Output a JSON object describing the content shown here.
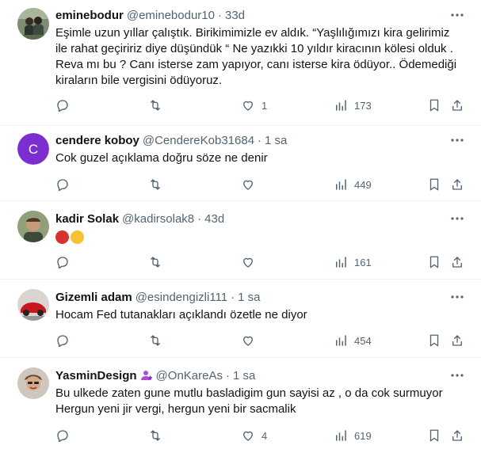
{
  "posts": [
    {
      "name": "eminebodur",
      "handle": "@eminebodur10",
      "time": "33d",
      "lines": [
        "Eşimle uzun yıllar çalıştık. Birikimimizle ev aldık. “Yaşlılığımızı kira gelirimiz",
        "ile rahat geçiririz diye düşündük “ Ne yazıkki 10 yıldır kiracının kölesi olduk .",
        "Reva mı bu ? Canı isterse zam yapıyor, canı isterse kira ödüyor.. Ödemediği",
        "kiraların bile vergisini ödüyoruz."
      ],
      "replies": "",
      "reposts": "",
      "likes": "1",
      "views": "173"
    },
    {
      "name": "cendere koboy",
      "handle": "@CendereKob31684",
      "time": "1 sa",
      "avatar_letter": "C",
      "lines": [
        "Cok guzel açıklama doğru söze ne denir"
      ],
      "replies": "",
      "reposts": "",
      "likes": "",
      "views": "449"
    },
    {
      "name": "kadir Solak",
      "handle": "@kadirsolak8",
      "time": "43d",
      "emojis": [
        "angry-face",
        "steam-face"
      ],
      "replies": "",
      "reposts": "",
      "likes": "",
      "views": "161"
    },
    {
      "name": "Gizemli adam",
      "handle": "@esindengizli111",
      "time": "1 sa",
      "lines": [
        "Hocam Fed tutanakları açıklandı özetle ne diyor"
      ],
      "replies": "",
      "reposts": "",
      "likes": "",
      "views": "454"
    },
    {
      "name": "YasminDesign",
      "handle": "@OnKareAs",
      "time": "1 sa",
      "lines": [
        "Bu ulkede zaten gune mutlu basladigim gun sayisi az , o da cok surmuyor",
        "Hergun yeni jir vergi, hergun yeni bir sacmalik"
      ],
      "replies": "",
      "reposts": "",
      "likes": "4",
      "views": "619"
    }
  ],
  "colors": {
    "text": "#0f1419",
    "secondary": "#536471",
    "divider": "#eff3f4",
    "avatar_purple": "#7b2fd0",
    "badge_purple": "#b04fd0"
  },
  "separator": "·"
}
